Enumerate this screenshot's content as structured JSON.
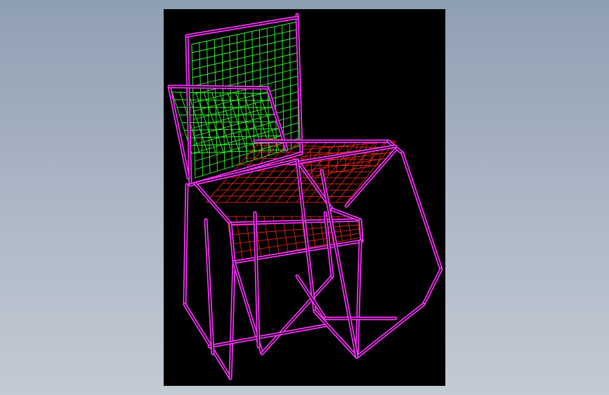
{
  "colors": {
    "background_top": "#8f9fb3",
    "background_bottom": "#c3cad4",
    "viewport_background": "#000000",
    "frame": "#ff33ff",
    "backrest_mesh": "#33ff33",
    "seat_mesh": "#ff2a1a"
  },
  "model": {
    "parts": [
      {
        "name": "frame",
        "color_key": "frame"
      },
      {
        "name": "backrest",
        "color_key": "backrest_mesh"
      },
      {
        "name": "seat",
        "color_key": "seat_mesh"
      }
    ]
  }
}
